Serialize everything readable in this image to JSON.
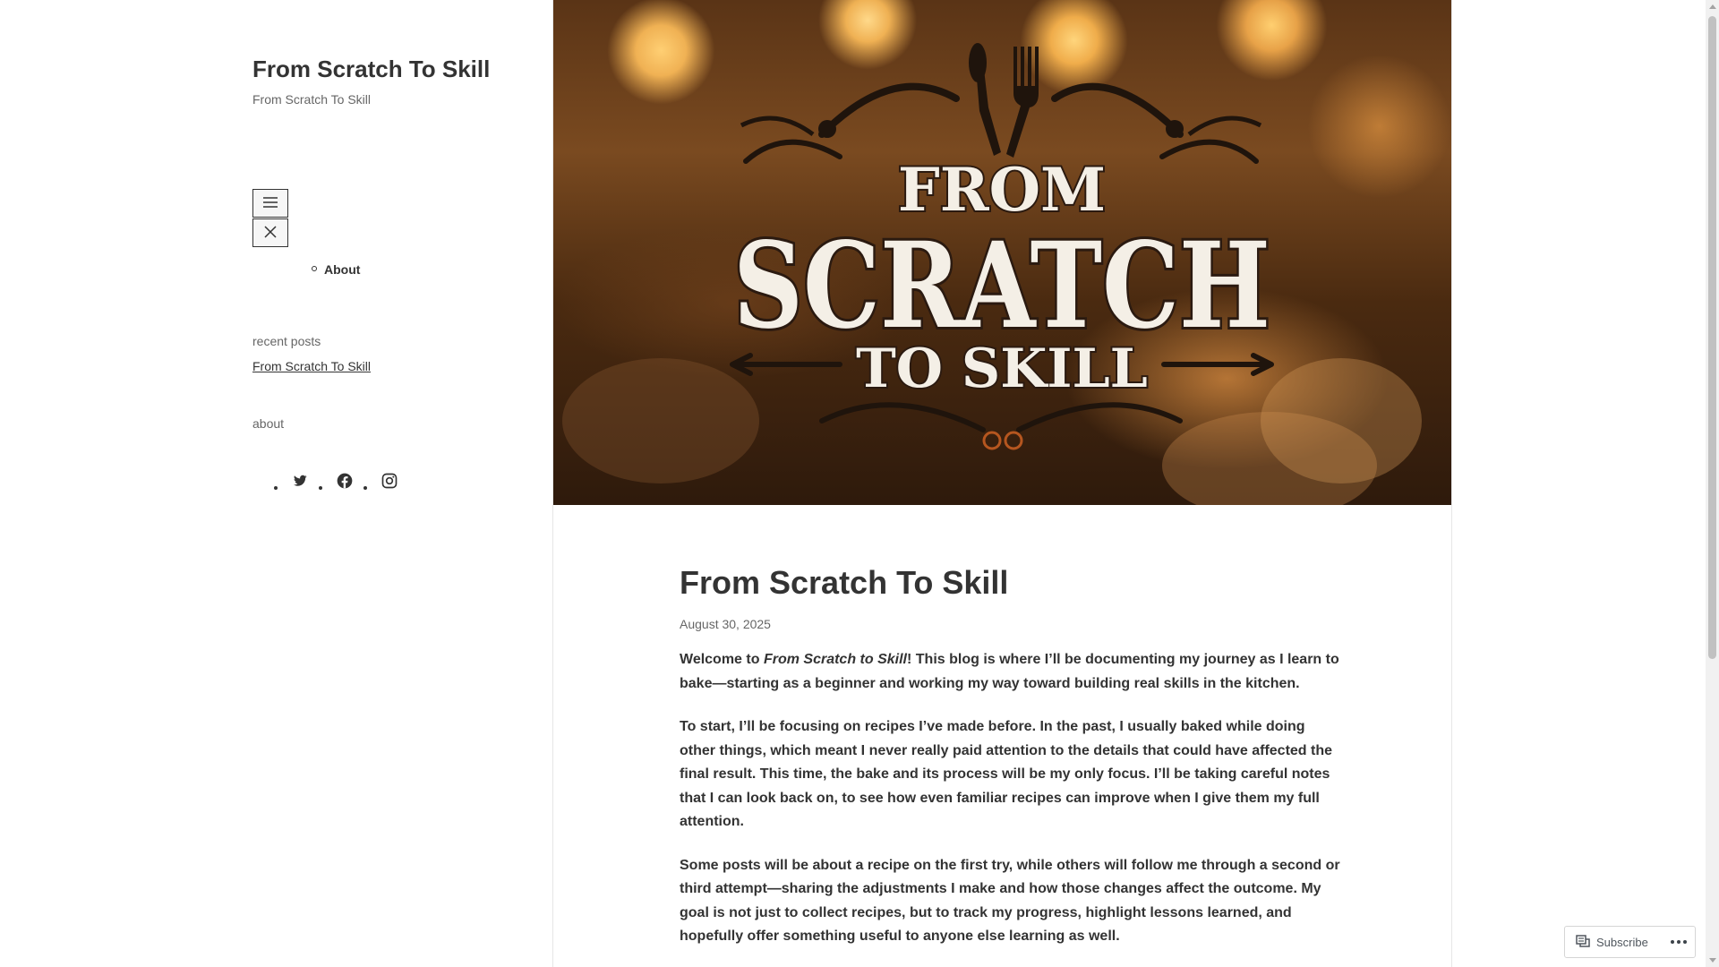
{
  "site": {
    "title": "From Scratch To Skill",
    "description": "From Scratch To Skill"
  },
  "nav": {
    "open_icon": "menu-icon",
    "close_icon": "close-icon",
    "items": [
      {
        "label": "About"
      }
    ]
  },
  "widgets": {
    "recent_posts_title": "recent posts",
    "recent_posts": [
      {
        "label": "From Scratch To Skill"
      }
    ],
    "about_title": "about",
    "social": [
      {
        "icon": "twitter-icon"
      },
      {
        "icon": "facebook-icon"
      },
      {
        "icon": "instagram-icon"
      }
    ]
  },
  "hero": {
    "logo_line1": "FROM",
    "logo_line2": "SCRATCH",
    "logo_line3": "TO SKILL",
    "icon": "fork-and-spoon-icon"
  },
  "post": {
    "title": "From Scratch To Skill",
    "date": "August 30, 2025",
    "p1_before": "Welcome to ",
    "p1_em": "From Scratch to Skill",
    "p1_after": "! This blog is where I’ll be documenting my journey as I learn to bake—starting as a beginner and working my way toward building real skills in the kitchen.",
    "p2": "To start, I’ll be focusing on recipes I’ve made before. In the past, I usually baked while doing other things, which meant I never really paid attention to the details that could have affected the final result. This time, the bake and its process will be my only focus. I’ll be taking careful notes that I can look back on, to see how even familiar recipes can improve when I give them my full attention.",
    "p3": "Some posts will be about a recipe on the first try, while others will follow me through a second or third attempt—sharing the adjustments I make and how those changes affect the outcome. My goal is not just to collect recipes, but to track my progress, highlight lessons learned, and hopefully offer something useful to anyone else learning as well."
  },
  "subscribe": {
    "label": "Subscribe",
    "icon": "reader-icon",
    "more_icon": "more-options-icon"
  },
  "colors": {
    "text": "#333333",
    "muted": "#666666",
    "border": "#e6e6e6",
    "logo_dark": "#2b1a10",
    "logo_light": "#f4efe6"
  }
}
